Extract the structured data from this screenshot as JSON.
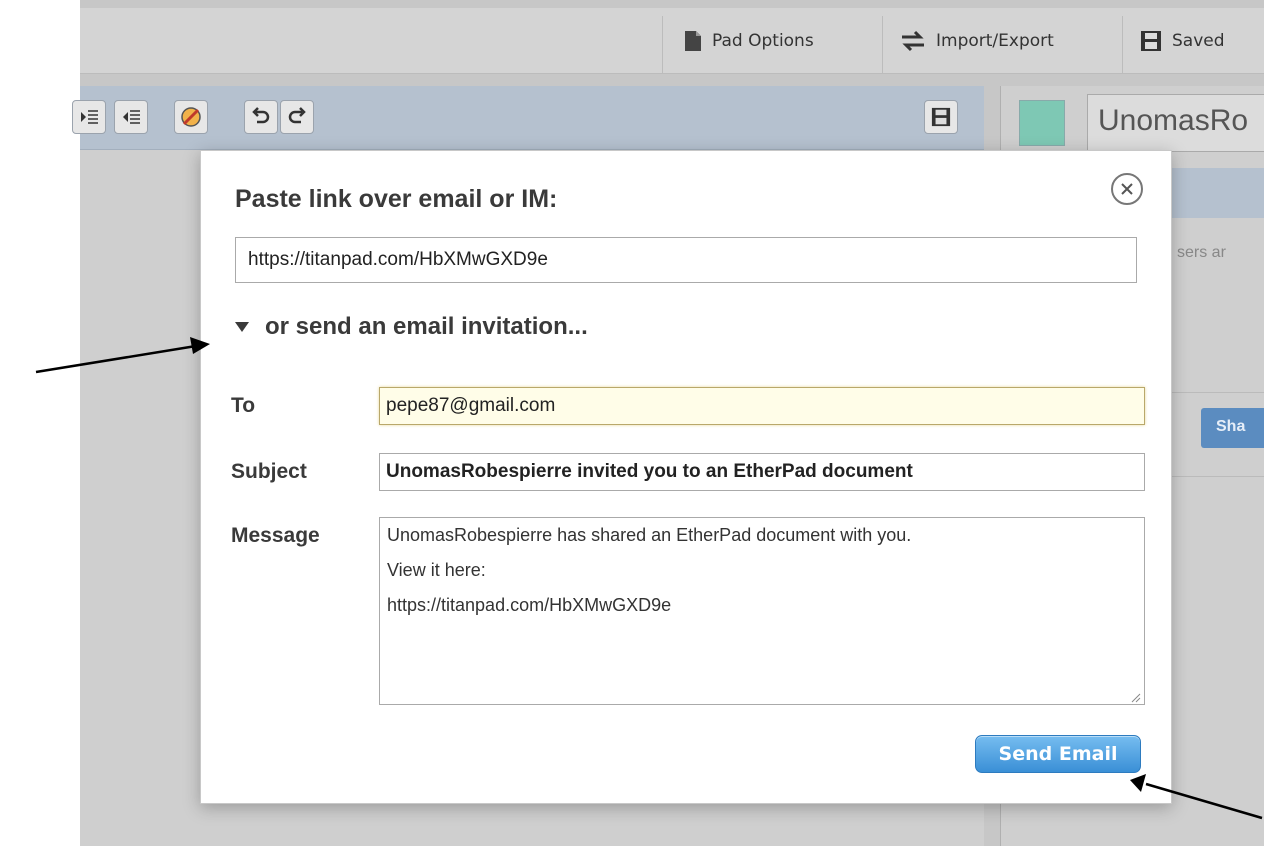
{
  "topbar": {
    "pad_options_label": "Pad Options",
    "import_export_label": "Import/Export",
    "saved_label": "Saved"
  },
  "right_panel": {
    "user_name": "UnomasRo",
    "users_text": "sers ar",
    "share_label": "Sha"
  },
  "modal": {
    "title": "Paste link over email or IM:",
    "link_value": "https://titanpad.com/HbXMwGXD9e",
    "invite_toggle_label": "or send an email invitation...",
    "to_label": "To",
    "to_value": "pepe87@gmail.com",
    "subject_label": "Subject",
    "subject_value": "UnomasRobespierre invited you to an EtherPad document",
    "message_label": "Message",
    "message_lines": [
      "UnomasRobespierre has shared an EtherPad document with you.",
      "View it here:",
      "https://titanpad.com/HbXMwGXD9e"
    ],
    "send_label": "Send Email"
  },
  "colors": {
    "accent_button": "#3a8fd6",
    "toolbar": "#b5c1cf",
    "user_swatch": "#7ec8b4"
  }
}
